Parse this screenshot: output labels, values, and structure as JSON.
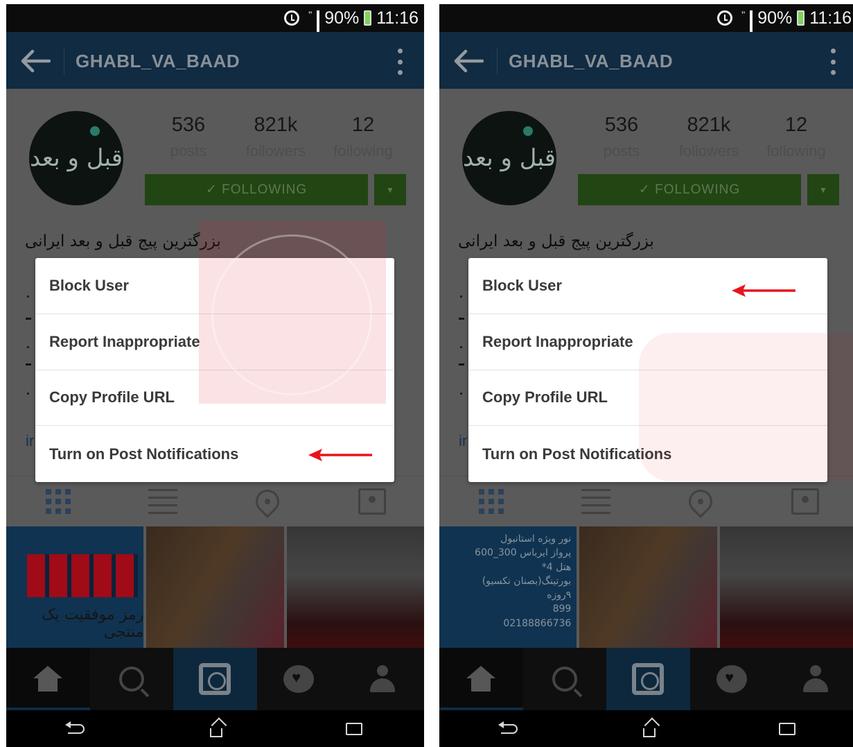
{
  "status_bar": {
    "signal_label": "\"",
    "battery": "90%",
    "time": "11:16"
  },
  "app_bar": {
    "title": "GHABL_VA_BAAD"
  },
  "profile": {
    "avatar_text": "قبل و بعد",
    "stats": [
      {
        "value": "536",
        "label": "posts"
      },
      {
        "value": "821k",
        "label": "followers"
      },
      {
        "value": "12",
        "label": "following"
      }
    ],
    "follow_button": "✓ FOLLOWING",
    "bio": "بزرگترین پیج قبل و بعد ایرانی",
    "link_fragment": "ir"
  },
  "menu": {
    "items": [
      "Block User",
      "Report Inappropriate",
      "Copy Profile URL",
      "Turn on Post Notifications"
    ]
  },
  "photos": {
    "left_caption": "رمز موفقیت یک منتجی",
    "right_caption": [
      "نور ویژه استانبول",
      "پرواز ایرباس 300_600",
      "هتل 4*",
      "بورتینگ(بصنان نکسیو)",
      "۹روزه",
      "899",
      "02188866736"
    ]
  },
  "colors": {
    "app_bar": "#163a5a",
    "follow_button": "#2e5d1c",
    "annotation_arrow": "#e8141c"
  },
  "icons": [
    "back-arrow-icon",
    "more-vert-icon",
    "grid-icon",
    "list-icon",
    "location-pin-icon",
    "tagged-icon",
    "home-icon",
    "search-icon",
    "camera-icon",
    "activity-icon",
    "profile-icon",
    "system-back-icon",
    "system-home-icon",
    "system-recents-icon"
  ]
}
